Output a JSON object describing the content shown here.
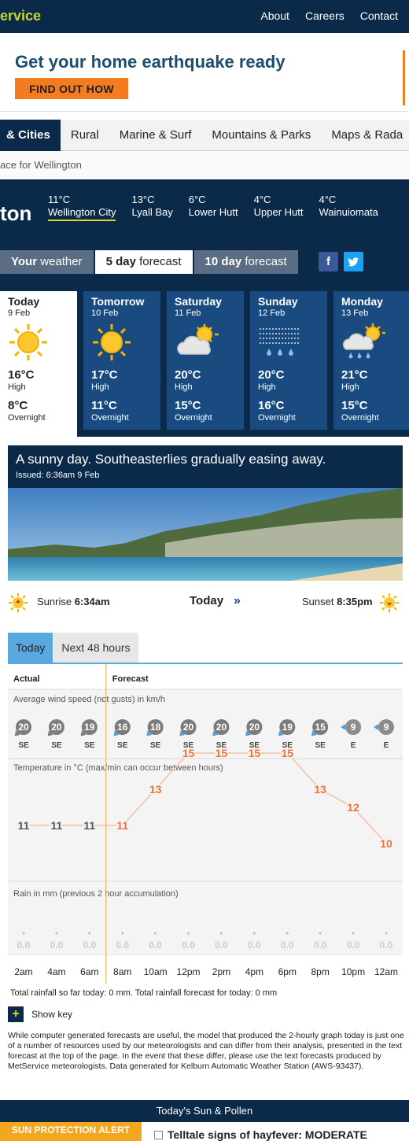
{
  "brand": "ervice",
  "topnav": [
    "About",
    "Careers",
    "Contact"
  ],
  "ad": {
    "headline": "Get your home earthquake ready",
    "button": "FIND OUT HOW"
  },
  "category_tabs": [
    "& Cities",
    "Rural",
    "Marine & Surf",
    "Mountains & Parks",
    "Maps & Rada"
  ],
  "breadcrumb": "ace for Wellington",
  "location": {
    "title": "ton",
    "nearby": [
      {
        "temp": "11°C",
        "name": "Wellington City"
      },
      {
        "temp": "13°C",
        "name": "Lyall Bay"
      },
      {
        "temp": "6°C",
        "name": "Lower Hutt"
      },
      {
        "temp": "4°C",
        "name": "Upper Hutt"
      },
      {
        "temp": "4°C",
        "name": "Wainuiomata"
      }
    ]
  },
  "view_tabs": [
    {
      "bold": "Your",
      "rest": " weather"
    },
    {
      "bold": "5 day",
      "rest": " forecast"
    },
    {
      "bold": "10 day",
      "rest": " forecast"
    }
  ],
  "days": [
    {
      "name": "Today",
      "date": "9 Feb",
      "icon": "sun-icon",
      "high": "16°C",
      "high_label": "High",
      "low": "8°C",
      "low_label": "Overnight"
    },
    {
      "name": "Tomorrow",
      "date": "10 Feb",
      "icon": "sun-icon",
      "high": "17°C",
      "high_label": "High",
      "low": "11°C",
      "low_label": "Overnight"
    },
    {
      "name": "Saturday",
      "date": "11 Feb",
      "icon": "partly-cloudy-icon",
      "high": "20°C",
      "high_label": "High",
      "low": "15°C",
      "low_label": "Overnight"
    },
    {
      "name": "Sunday",
      "date": "12 Feb",
      "icon": "drizzle-fog-icon",
      "high": "20°C",
      "high_label": "High",
      "low": "16°C",
      "low_label": "Overnight"
    },
    {
      "name": "Monday",
      "date": "13 Feb",
      "icon": "sun-showers-icon",
      "high": "21°C",
      "high_label": "High",
      "low": "15°C",
      "low_label": "Overnight"
    }
  ],
  "summary": {
    "headline": "A sunny day. Southeasterlies gradually easing away.",
    "issued": "Issued: 6:36am 9 Feb"
  },
  "sun": {
    "sunrise_label": "Sunrise ",
    "sunrise": "6:34am",
    "center": "Today",
    "sunset_label": "Sunset ",
    "sunset": "8:35pm"
  },
  "chart_tabs": [
    "Today",
    "Next 48 hours"
  ],
  "chart_data": {
    "type": "line",
    "actual_label": "Actual",
    "forecast_label": "Forecast",
    "x": [
      "2am",
      "4am",
      "6am",
      "8am",
      "10am",
      "12pm",
      "2pm",
      "4pm",
      "6pm",
      "8pm",
      "10pm",
      "12am"
    ],
    "wind": {
      "title": "Average wind speed (not gusts) in km/h",
      "speeds": [
        20,
        20,
        19,
        16,
        18,
        20,
        20,
        20,
        19,
        15,
        9,
        9
      ],
      "directions": [
        "SE",
        "SE",
        "SE",
        "SE",
        "SE",
        "SE",
        "SE",
        "SE",
        "SE",
        "SE",
        "E",
        "E"
      ]
    },
    "temperature": {
      "title": "Temperature in °C (max/min can occur between hours)",
      "values": [
        11,
        11,
        11,
        11,
        13,
        15,
        15,
        15,
        15,
        13,
        12,
        10
      ]
    },
    "rain": {
      "title": "Rain in mm (previous 2 hour accumulation)",
      "values": [
        "0.0",
        "0.0",
        "0.0",
        "0.0",
        "0.0",
        "0.0",
        "0.0",
        "0.0",
        "0.0",
        "0.0",
        "0.0",
        "0.0"
      ]
    },
    "actual_count": 3,
    "colors": {
      "actual": "#555555",
      "forecast": "#e8743b",
      "line": "#f6c0a3",
      "divider": "#e6b84a"
    }
  },
  "rainfall_text": "Total rainfall so far today: 0 mm. Total rainfall forecast for today: 0 mm",
  "show_key": "Show key",
  "disclaimer": "While computer generated forecasts are useful, the model that produced the 2-hourly graph today is just one of a number of resources used by our meteorologists and can differ from their analysis, presented in the text forecast at the top of the page. In the event that these differ, please use the text forecasts produced by MetService meteorologists. Data generated for Kelburn Automatic Weather Station (AWS-93437).",
  "sun_pollen_title": "Today's Sun & Pollen",
  "sun_alert": "SUN PROTECTION ALERT",
  "hayfever": "Telltale signs of hayfever: MODERATE"
}
